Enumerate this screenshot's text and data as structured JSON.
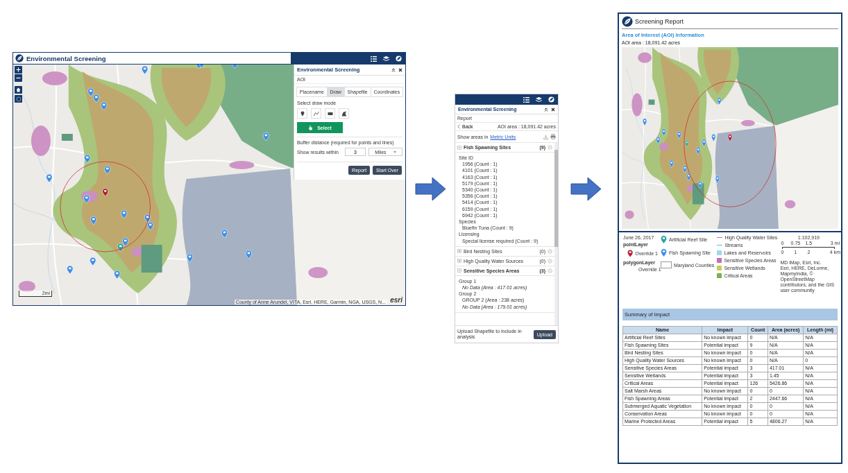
{
  "map_app": {
    "title": "Environmental Screening",
    "map": {
      "scale": "2mi",
      "logo": "esri",
      "attribution": "County of Anne Arundel, VITA, Esri, HERE, Garmin, NGA, USGS, N..."
    },
    "widget": {
      "title": "Environmental Screening",
      "section": "AOI",
      "tabs": [
        {
          "label": "Placename",
          "selected": false
        },
        {
          "label": "Draw",
          "selected": true
        },
        {
          "label": "Shapefile",
          "selected": false
        },
        {
          "label": "Coordinates",
          "selected": false
        }
      ],
      "draw_mode_label": "Select draw mode",
      "draw_tools": [
        {
          "kind": "point"
        },
        {
          "kind": "polyline"
        },
        {
          "kind": "rectangle"
        },
        {
          "kind": "polygon"
        }
      ],
      "select_button": "Select",
      "buffer_label": "Buffer distance (required for points and lines)",
      "results_label": "Show results within",
      "distance": "3",
      "unit": "Miles",
      "buttons": [
        "Report",
        "Start Over"
      ]
    }
  },
  "report_app": {
    "title": "Environmental Screening",
    "section": "Report",
    "back": "Back",
    "aoi_area": "AOI area : 18,091.42 acres",
    "units_prefix": "Show areas in",
    "units_link": "Metric Units",
    "sections": [
      {
        "title": "Fish Spawning Sites",
        "count": "(9)",
        "expanded": true,
        "groups": [
          {
            "label": "Site ID",
            "items": [
              {
                "text": "1956 (Count : 1)",
                "kind": "value"
              },
              {
                "text": "4101 (Count : 1)",
                "kind": "value"
              },
              {
                "text": "4163 (Count : 1)",
                "kind": "value"
              },
              {
                "text": "5179 (Count : 1)",
                "kind": "value"
              },
              {
                "text": "5340 (Count : 1)",
                "kind": "value"
              },
              {
                "text": "5356 (Count : 1)",
                "kind": "value"
              },
              {
                "text": "5414 (Count : 1)",
                "kind": "value"
              },
              {
                "text": "6159 (Count : 1)",
                "kind": "value"
              },
              {
                "text": "6942 (Count : 1)",
                "kind": "value"
              }
            ]
          },
          {
            "label": "Species",
            "items": [
              {
                "text": "Bluefin Tuna (Count : 9)",
                "kind": "value"
              }
            ]
          },
          {
            "label": "Licensing",
            "items": [
              {
                "text": "Special license required (Count : 9)",
                "kind": "value"
              }
            ]
          }
        ]
      },
      {
        "title": "Bird Nesting Sites",
        "count": "(0)",
        "expanded": false
      },
      {
        "title": "High Quality Water Sources",
        "count": "(0)",
        "expanded": false
      },
      {
        "title": "Sensitive Species Areas",
        "count": "(3)",
        "expanded": true,
        "groups": [
          {
            "label": "Group 1",
            "items": [
              {
                "text": "No Data (Area : 417.01 acres)",
                "kind": "empty"
              }
            ]
          },
          {
            "label": "Group 2",
            "items": [
              {
                "text": "GROUP 2 (Area : 238 acres)",
                "kind": "value"
              },
              {
                "text": "No Data (Area : 179.01 acres)",
                "kind": "empty"
              }
            ]
          }
        ]
      }
    ],
    "upload_label": "Upload Shapefile to include in analysis",
    "upload_button": "Upload"
  },
  "report": {
    "title": "Screening Report",
    "section_title": "Area of Interest (AOI) Information",
    "aoi_area": "AOI area : 18,091.42 acres",
    "legend": {
      "date": "June 26, 2017",
      "layers": [
        {
          "name": "pointLayer",
          "label": "Override 1",
          "kind": "pin"
        },
        {
          "name": "polygonLayer",
          "label": "Override 1",
          "kind": "polygon"
        }
      ],
      "symbols": [
        {
          "label": "Artificial Reef Site",
          "kind": "pin",
          "color": "#1fa59a"
        },
        {
          "label": "Fish Spawning Site",
          "kind": "pin",
          "color": "#3d8ee6"
        },
        {
          "label": "Maryland Counties",
          "kind": "outline"
        }
      ],
      "classes": [
        {
          "label": "High Quality Water Sites",
          "kind": "line",
          "color": "#c06ac0"
        },
        {
          "label": "Streams",
          "kind": "line",
          "color": "#6aaee0"
        },
        {
          "label": "Lakes and Reservoirs",
          "kind": "fill",
          "color": "#9fd8ef"
        },
        {
          "label": "Sensitive Species Areas",
          "kind": "fill",
          "color": "#c56fb1"
        },
        {
          "label": "Sensitive Wetlands",
          "kind": "fill",
          "color": "#c8cc5a"
        },
        {
          "label": "Critical Areas",
          "kind": "fill",
          "color": "#7fae4f"
        }
      ],
      "scale": {
        "ratio": "1:102,919",
        "mi_ticks": [
          "0",
          "0.75",
          "1.5",
          "3 mi"
        ],
        "km_ticks": [
          "0",
          "1",
          "2",
          "4 km"
        ]
      },
      "attribution": [
        "MD iMap, Esri, Inc.",
        "Esri, HERE, DeLorme, MapmyIndia, © OpenStreetMap contributors, and the GIS user community"
      ]
    },
    "summary": {
      "title": "Summary of Impact",
      "columns": [
        "Name",
        "Impact",
        "Count",
        "Area (acres)",
        "Length (mi)"
      ],
      "rows": [
        [
          "Artificial Reef Sites",
          "No known impact",
          "0",
          "N/A",
          "N/A"
        ],
        [
          "Fish Spawning Sites",
          "Potential impact",
          "9",
          "N/A",
          "N/A"
        ],
        [
          "Bird Nesting Sites",
          "No known impact",
          "0",
          "N/A",
          "N/A"
        ],
        [
          "High Quality Water Sources",
          "No known impact",
          "0",
          "N/A",
          "0"
        ],
        [
          "Sensitive Species Areas",
          "Potential impact",
          "3",
          "417.01",
          "N/A"
        ],
        [
          "Sensitive Wetlands",
          "Potential impact",
          "3",
          "1.45",
          "N/A"
        ],
        [
          "Critical Areas",
          "Potential impact",
          "126",
          "5426.86",
          "N/A"
        ],
        [
          "Salt Marsh Areas",
          "No known impact",
          "0",
          "0",
          "N/A"
        ],
        [
          "Fish Spawning Areas",
          "Potential impact",
          "2",
          "2447.66",
          "N/A"
        ],
        [
          "Submerged Aquatic Vegetation",
          "No known impact",
          "0",
          "0",
          "N/A"
        ],
        [
          "Conservation Areas",
          "No known impact",
          "0",
          "0",
          "N/A"
        ],
        [
          "Marine Protected Areas",
          "Potential impact",
          "5",
          "4806.27",
          "N/A"
        ]
      ]
    }
  }
}
